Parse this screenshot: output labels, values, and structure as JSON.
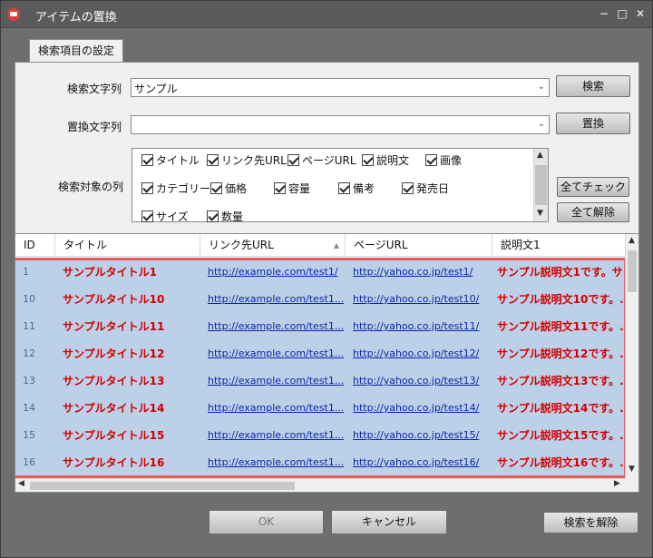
{
  "window": {
    "title": "アイテムの置換",
    "min": "−",
    "max": "□",
    "close": "✕"
  },
  "tab": {
    "label": "検索項目の設定"
  },
  "search": {
    "label": "検索文字列",
    "value": "サンプル",
    "button": "検索"
  },
  "replace": {
    "label": "置換文字列",
    "value": "",
    "button": "置換"
  },
  "target": {
    "label": "検索対象の列",
    "checkboxes": [
      "タイトル",
      "リンク先URL",
      "ページURL",
      "説明文",
      "画像",
      "カテゴリー",
      "価格",
      "容量",
      "備考",
      "発売日",
      "サイズ",
      "数量"
    ],
    "check_all": "全てチェック",
    "uncheck_all": "全て解除"
  },
  "grid": {
    "headers": [
      "ID",
      "タイトル",
      "リンク先URL",
      "ページURL",
      "説明文1"
    ],
    "rows": [
      {
        "id": "1",
        "title": "サンプルタイトル1",
        "link": "http://example.com/test1/",
        "page": "http://yahoo.co.jp/test1/",
        "desc": "サンプル説明文1です。サ..."
      },
      {
        "id": "10",
        "title": "サンプルタイトル10",
        "link": "http://example.com/test1...",
        "page": "http://yahoo.co.jp/test10/",
        "desc": "サンプル説明文10です。..."
      },
      {
        "id": "11",
        "title": "サンプルタイトル11",
        "link": "http://example.com/test1...",
        "page": "http://yahoo.co.jp/test11/",
        "desc": "サンプル説明文11です。..."
      },
      {
        "id": "12",
        "title": "サンプルタイトル12",
        "link": "http://example.com/test1...",
        "page": "http://yahoo.co.jp/test12/",
        "desc": "サンプル説明文12です。..."
      },
      {
        "id": "13",
        "title": "サンプルタイトル13",
        "link": "http://example.com/test1...",
        "page": "http://yahoo.co.jp/test13/",
        "desc": "サンプル説明文13です。..."
      },
      {
        "id": "14",
        "title": "サンプルタイトル14",
        "link": "http://example.com/test1...",
        "page": "http://yahoo.co.jp/test14/",
        "desc": "サンプル説明文14です。..."
      },
      {
        "id": "15",
        "title": "サンプルタイトル15",
        "link": "http://example.com/test1...",
        "page": "http://yahoo.co.jp/test15/",
        "desc": "サンプル説明文15です。..."
      },
      {
        "id": "16",
        "title": "サンプルタイトル16",
        "link": "http://example.com/test1...",
        "page": "http://yahoo.co.jp/test16/",
        "desc": "サンプル説明文16です。..."
      }
    ]
  },
  "footer": {
    "ok": "OK",
    "cancel": "キャンセル",
    "clear_search": "検索を解除"
  },
  "colors": {
    "accent_red": "#d40000",
    "link_blue": "#0a27a8",
    "selection": "#bcd0e8",
    "highlight_border": "#e85c5c"
  }
}
